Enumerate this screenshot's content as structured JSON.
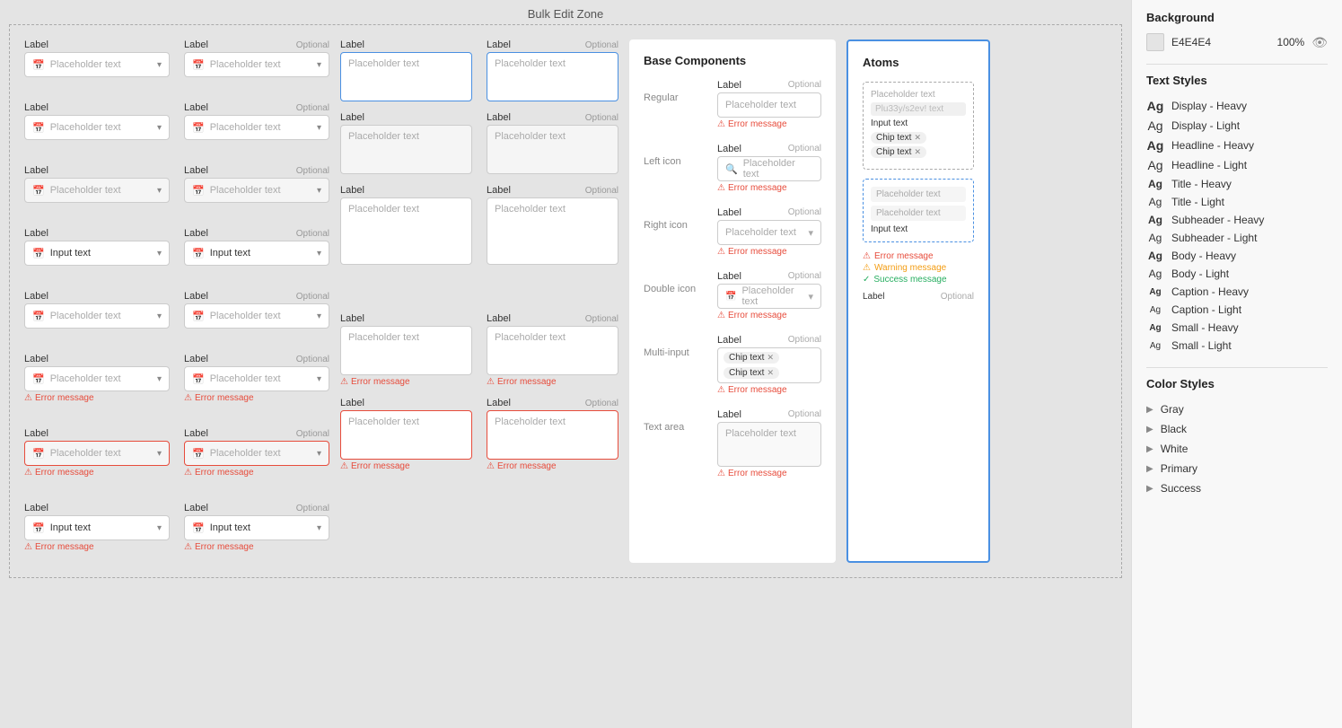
{
  "header": {
    "bulk_edit_label": "Bulk Edit Zone"
  },
  "background": {
    "section_title": "Background",
    "color": "E4E4E4",
    "opacity": "100%"
  },
  "text_styles": {
    "section_title": "Text Styles",
    "items": [
      {
        "id": "display-heavy",
        "ag": "Ag",
        "label": "Display - Heavy",
        "size": "large",
        "weight": "bold"
      },
      {
        "id": "display-light",
        "ag": "Ag",
        "label": "Display - Light",
        "size": "large",
        "weight": "normal"
      },
      {
        "id": "headline-heavy",
        "ag": "Ag",
        "label": "Headline - Heavy",
        "size": "large",
        "weight": "bold"
      },
      {
        "id": "headline-light",
        "ag": "Ag",
        "label": "Headline - Light",
        "size": "large",
        "weight": "normal"
      },
      {
        "id": "title-heavy",
        "ag": "Ag",
        "label": "Title - Heavy",
        "size": "medium",
        "weight": "bold"
      },
      {
        "id": "title-light",
        "ag": "Ag",
        "label": "Title - Light",
        "size": "medium",
        "weight": "normal"
      },
      {
        "id": "subheader-heavy",
        "ag": "Ag",
        "label": "Subheader - Heavy",
        "size": "medium",
        "weight": "bold"
      },
      {
        "id": "subheader-light",
        "ag": "Ag",
        "label": "Subheader - Light",
        "size": "medium",
        "weight": "normal"
      },
      {
        "id": "body-heavy",
        "ag": "Ag",
        "label": "Body - Heavy",
        "size": "medium",
        "weight": "bold"
      },
      {
        "id": "body-light",
        "ag": "Ag",
        "label": "Body - Light",
        "size": "medium",
        "weight": "normal"
      },
      {
        "id": "caption-heavy",
        "ag": "Ag",
        "label": "Caption - Heavy",
        "size": "small",
        "weight": "bold"
      },
      {
        "id": "caption-light",
        "ag": "Ag",
        "label": "Caption - Light",
        "size": "small",
        "weight": "normal"
      },
      {
        "id": "small-heavy",
        "ag": "Ag",
        "label": "Small - Heavy",
        "size": "small",
        "weight": "bold"
      },
      {
        "id": "small-light",
        "ag": "Ag",
        "label": "Small - Light",
        "size": "small",
        "weight": "normal"
      }
    ]
  },
  "color_styles": {
    "section_title": "Color Styles",
    "items": [
      {
        "id": "gray",
        "label": "Gray"
      },
      {
        "id": "black",
        "label": "Black"
      },
      {
        "id": "white",
        "label": "White"
      },
      {
        "id": "primary",
        "label": "Primary"
      },
      {
        "id": "success",
        "label": "Success"
      }
    ]
  },
  "base_components": {
    "title": "Base Components",
    "rows": [
      {
        "type": "Regular",
        "label": "Label",
        "optional": "Optional",
        "placeholder": "Placeholder text",
        "error": "Error message"
      },
      {
        "type": "Left icon",
        "label": "Label",
        "optional": "Optional",
        "placeholder": "Placeholder text",
        "error": "Error message",
        "has_search_icon": true
      },
      {
        "type": "Right icon",
        "label": "Label",
        "optional": "Optional",
        "placeholder": "Placeholder text",
        "error": "Error message",
        "has_chevron": true
      },
      {
        "type": "Double icon",
        "label": "Label",
        "optional": "Optional",
        "placeholder": "Placeholder text",
        "error": "Error message",
        "has_cal_icon": true,
        "has_chevron": true
      },
      {
        "type": "Multi-input",
        "label": "Label",
        "optional": "Optional",
        "chips": [
          "Chip text",
          "Chip text"
        ],
        "error": "Error message"
      },
      {
        "type": "Text area",
        "label": "Label",
        "optional": "Optional",
        "placeholder": "Placeholder text",
        "error": "Error message"
      }
    ]
  },
  "atoms": {
    "title": "Atoms",
    "field1": {
      "placeholder": "Placeholder text",
      "fuzzy_text": "Plu33y/s2ev! text",
      "input_label": "Input text",
      "chips": [
        "Chip text",
        "Chip text"
      ]
    },
    "field2": {
      "placeholder": "Placeholder text",
      "placeholder2": "Placeholder text",
      "input_label": "Input text"
    },
    "errors": {
      "error": "Error message",
      "warning": "Warning message",
      "success": "Success message"
    },
    "bottom_label": "Label",
    "bottom_optional": "Optional"
  },
  "form_fields": {
    "label": "Label",
    "optional": "Optional",
    "placeholder": "Placeholder text",
    "input_text": "Input text",
    "error": "Error message"
  }
}
